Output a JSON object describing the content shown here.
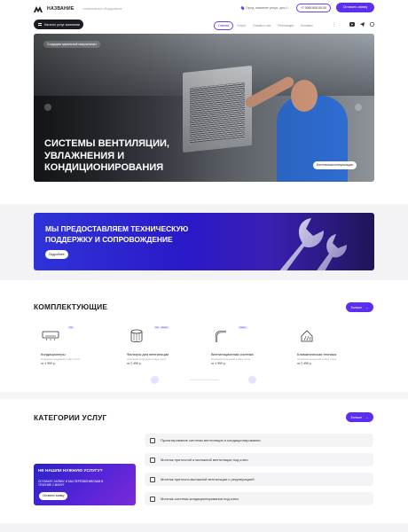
{
  "header": {
    "logo_text": "НАЗВАНИЕ",
    "tagline": "климатическое оборудование",
    "address": "Город, название улицы, дом 1",
    "phone": "+7 0000 000-00-00",
    "cta_label": "Оставить заявку",
    "catalog_button": "Каталог услуг компании",
    "nav": [
      "Главная",
      "Услуги",
      "Отзывы о нас",
      "Реализация",
      "Контакты"
    ],
    "nav_active_index": 0,
    "more_icon": "vertical-dots-icon",
    "social_icons": [
      "youtube-icon",
      "telegram-icon",
      "whatsapp-icon"
    ],
    "accent_color": "#5b2ef0"
  },
  "hero": {
    "pill": "Создадим идеальный микроклимат",
    "title_lines": [
      "СИСТЕМЫ ВЕНТИЛЯЦИИ,",
      "УВЛАЖНЕНИЯ И",
      "КОНДИЦИОНИРОВАНИЯ"
    ],
    "button": "Бесплатная консультация"
  },
  "banner": {
    "title": "МЫ ПРЕДОСТАВЛЯЕМ ТЕХНИЧЕСКУЮ ПОДДЕРЖКУ И СОПРОВОЖДЕНИЕ",
    "button": "Подробнее"
  },
  "components": {
    "title": "КОМПЛЕКТУЮЩИЕ",
    "more_button": "Больше",
    "cards": [
      {
        "icon": "air-conditioner-icon",
        "badge": "Хит",
        "name": "Кондиционеры",
        "desc": "Описание продукции в пару строк",
        "price": "от 1 990 р."
      },
      {
        "icon": "air-filter-icon",
        "badge": "Хит · Новое",
        "name": "Фильтры для вентиляции",
        "desc": "Описание продукции в пару строк",
        "price": "от 2 499 р."
      },
      {
        "icon": "duct-pipe-icon",
        "badge": "Новое",
        "name": "Вентиляционная система",
        "desc": "Описание продукции в пару строк",
        "price": "от 1 990 р."
      },
      {
        "icon": "climate-house-icon",
        "badge": "",
        "name": "Климатическая техника",
        "desc": "Описание продукции в пару строк",
        "price": "от 2 499 р."
      }
    ]
  },
  "categories": {
    "title": "КАТЕГОРИИ УСЛУГ",
    "more_button": "Больше",
    "services": [
      {
        "icon": "ventilation-design-icon",
        "label": "Проектирование системы вентиляции и кондиционирования"
      },
      {
        "icon": "ventilation-install-icon",
        "label": "Монтаж приточной и вытяжной вентиляции под ключ"
      },
      {
        "icon": "recuperation-icon",
        "label": "Монтаж приточно-вытяжной вентиляции с рекуперацией"
      },
      {
        "icon": "ac-install-icon",
        "label": "Монтаж системы кондиционирования под ключ"
      }
    ],
    "promo": {
      "title": "НЕ НАШЛИ НУЖНУЮ УСЛУГУ?",
      "text": "ОСТАВЬТЕ ЗАЯВКУ И МЫ ПЕРЕЗВОНИМ ВАМ В ТЕЧЕНИЕ 2 МИНУТ",
      "button": "Оставить заявку"
    }
  }
}
